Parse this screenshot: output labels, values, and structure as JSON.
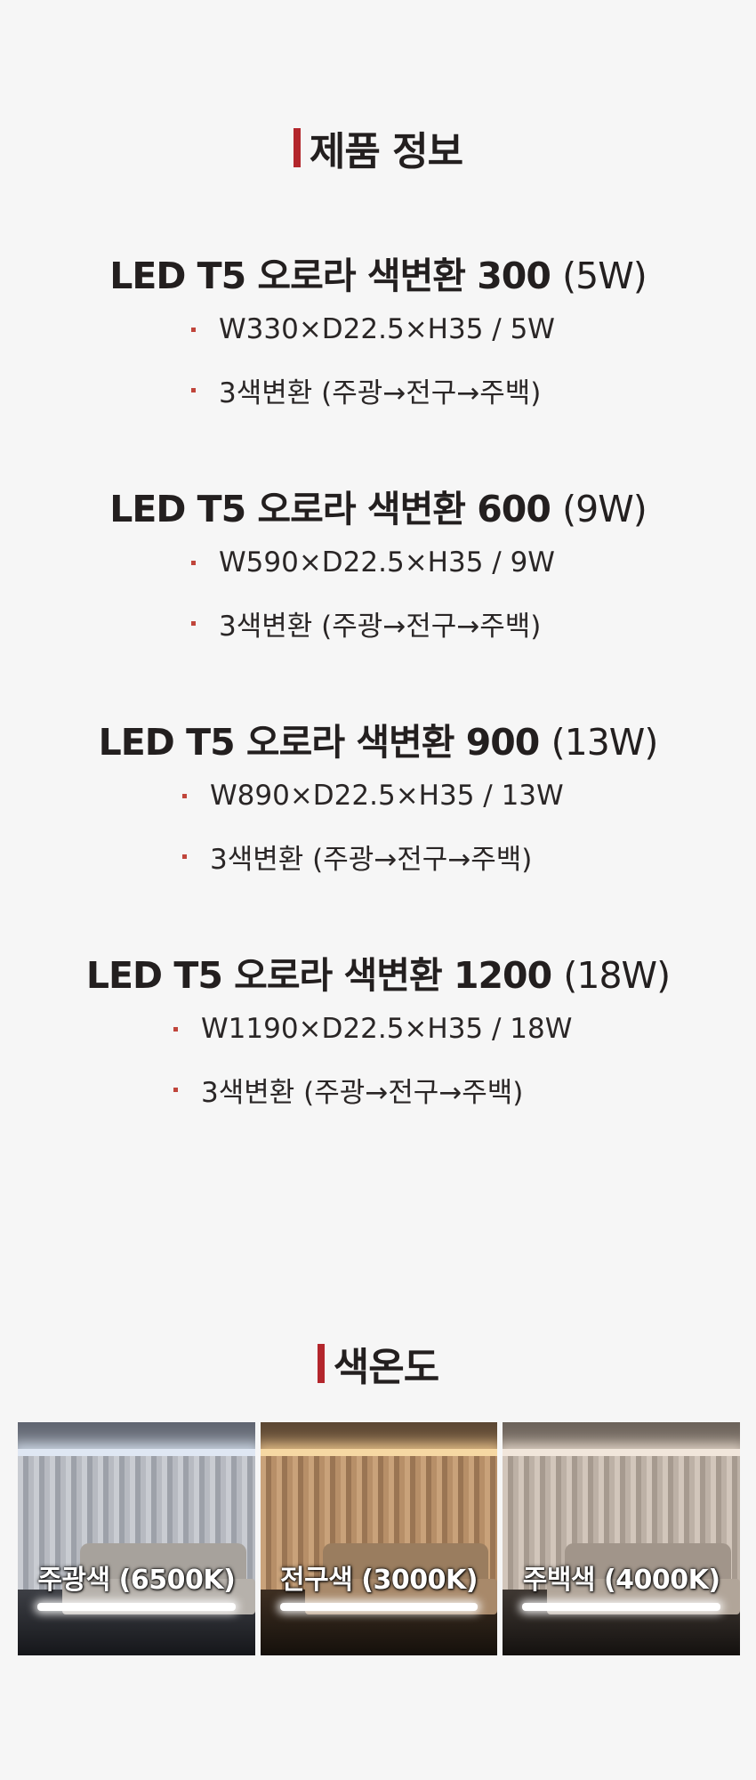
{
  "product_info": {
    "title": "제품 정보",
    "products": [
      {
        "name": "LED T5 오로라 색변환 300",
        "watt": "(5W)",
        "specs": [
          "W330×D22.5×H35  /  5W",
          "3색변환 (주광→전구→주백)"
        ]
      },
      {
        "name": "LED T5 오로라 색변환 600",
        "watt": "(9W)",
        "specs": [
          "W590×D22.5×H35  /  9W",
          "3색변환 (주광→전구→주백)"
        ]
      },
      {
        "name": "LED T5 오로라 색변환 900",
        "watt": "(13W)",
        "specs": [
          "W890×D22.5×H35  /  13W",
          "3색변환 (주광→전구→주백)"
        ]
      },
      {
        "name": "LED T5 오로라 색변환 1200",
        "watt": "(18W)",
        "specs": [
          "W1190×D22.5×H35  /  18W",
          "3색변환 (주광→전구→주백)"
        ]
      }
    ]
  },
  "color_temp": {
    "title": "색온도",
    "items": [
      {
        "label": "주광색 (6500K)",
        "tone": "daylight"
      },
      {
        "label": "전구색 (3000K)",
        "tone": "warm"
      },
      {
        "label": "주백색 (4000K)",
        "tone": "neutral"
      }
    ]
  },
  "colors": {
    "accent": "#b3262c",
    "bullet": "#c0453b",
    "text": "#231f1f",
    "background": "#f6f6f6"
  }
}
